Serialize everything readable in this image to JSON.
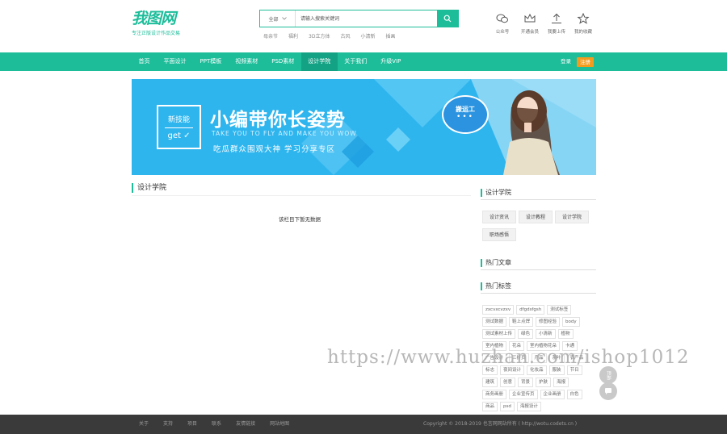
{
  "header": {
    "logo_text": "我图网",
    "logo_slogan": "专注正版设计作品交易",
    "search": {
      "category": "全部",
      "placeholder": "请输入搜索关键词",
      "hot_words": [
        "母亲节",
        "福利",
        "3D立方体",
        "古风",
        "小清新",
        "插画"
      ]
    },
    "quick_links": [
      {
        "label": "公众号",
        "icon": "wechat-icon"
      },
      {
        "label": "开通会员",
        "icon": "crown-icon"
      },
      {
        "label": "我要上传",
        "icon": "upload-icon"
      },
      {
        "label": "我的收藏",
        "icon": "star-icon"
      }
    ]
  },
  "nav": {
    "items": [
      "首页",
      "平面设计",
      "PPT模板",
      "视频素材",
      "PSD素材",
      "设计学院",
      "关于我们",
      "升级VIP"
    ],
    "active_index": 5,
    "login": "登录",
    "register": "注册"
  },
  "banner": {
    "box_top": "新技能",
    "box_bottom": "get",
    "title": "小编带你长姿势",
    "subtitle_en": "TAKE YOU TO FLY AND MAKE YOU WOW",
    "subtitle_cn": "吃瓜群众围观大神 学习分享专区",
    "bubble_text": "搬运工",
    "bubble_dots": "•••"
  },
  "main": {
    "section_title": "设计学院",
    "empty_message": "该栏目下暂无数据"
  },
  "sidebar": {
    "academy_title": "设计学院",
    "categories": [
      "设计资讯",
      "设计教程",
      "设计学院",
      "职场感悟"
    ],
    "hot_articles_title": "热门文章",
    "hot_tags_title": "热门标签",
    "tags": [
      "zxcvxcvzxv",
      "dfgdsfgsh",
      "测试标签",
      "测试数据",
      "鞋上点焊",
      "修图经验",
      "body",
      "测试素材上传",
      "绿色",
      "小清新",
      "植物",
      "室内植物",
      "花朵",
      "室内植物花朵",
      "卡通",
      "广告设计",
      "三折页",
      "产品",
      "茶叶",
      "农产品",
      "标志",
      "夜间设计",
      "化妆品",
      "服装",
      "节日",
      "建筑",
      "创意",
      "背景",
      "护肤",
      "海报",
      "商务画册",
      "企业宣传页",
      "企业画册",
      "白色",
      "商品",
      "psd",
      "海报设计"
    ]
  },
  "float": {
    "top_label": "顶部"
  },
  "watermark": "https://www.huzhan.com/ishop1012",
  "footer": {
    "links": [
      "关于",
      "支持",
      "项目",
      "联系",
      "友情链接",
      "网站地图"
    ],
    "copyright": "Copyright © 2018-2019 也言网网站所有 ( http://wotu.codets.cn )"
  },
  "colors": {
    "brand": "#1dbd9a",
    "nav_active": "#14a285",
    "register": "#f39b1d",
    "banner": "#2fb5ee",
    "footer": "#3a3a3a"
  }
}
